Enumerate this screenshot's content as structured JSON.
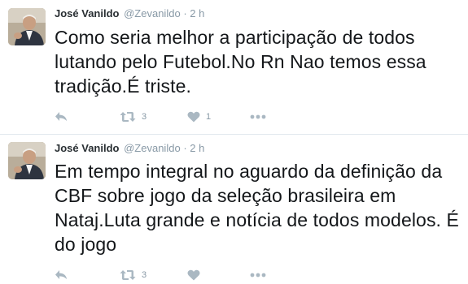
{
  "colors": {
    "text": "#14171a",
    "meta": "#8899a6",
    "icon": "#aab8c2",
    "divider": "#e1e8ed"
  },
  "tweets": [
    {
      "author_name": "José Vanildo",
      "username": "@Zevanildo",
      "separator": "·",
      "time": "2 h",
      "text": "Como seria melhor a participação de todos lutando pelo Futebol.No Rn Nao temos essa tradição.É triste.",
      "retweet_count": "3",
      "like_count": "1",
      "icons": [
        "reply-icon",
        "retweet-icon",
        "heart-icon",
        "more-icon"
      ]
    },
    {
      "author_name": "José Vanildo",
      "username": "@Zevanildo",
      "separator": "·",
      "time": "2 h",
      "text": "Em tempo integral no aguardo da definição da CBF sobre jogo da seleção brasileira em Nataj.Luta grande e notícia de todos modelos. É do jogo",
      "retweet_count": "3",
      "like_count": "",
      "icons": [
        "reply-icon",
        "retweet-icon",
        "heart-icon",
        "more-icon"
      ]
    }
  ]
}
